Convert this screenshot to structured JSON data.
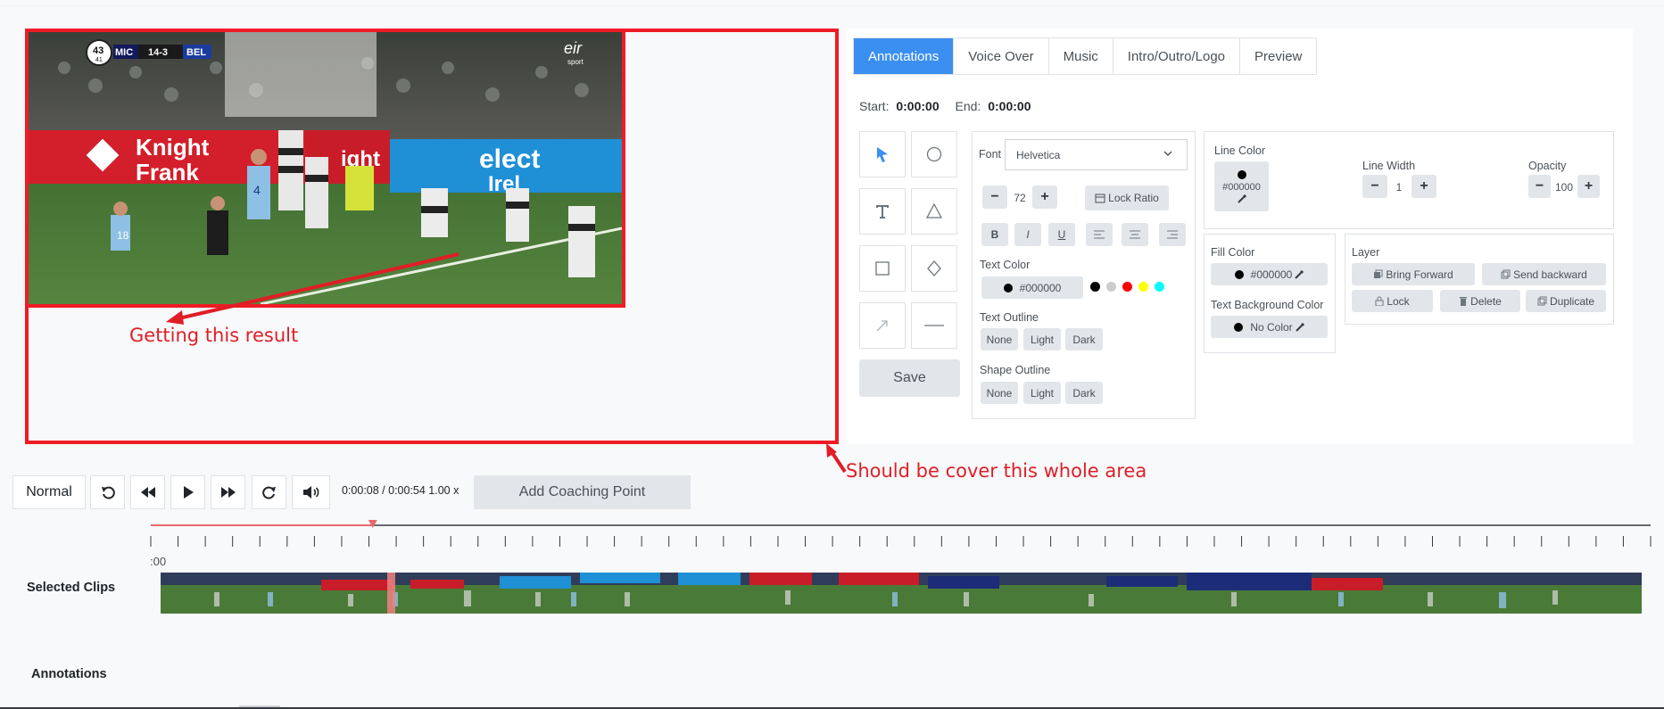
{
  "annotations": {
    "result_label": "Getting this result",
    "cover_label": "Should be cover this whole area"
  },
  "video": {
    "scoreboard": {
      "period": "43",
      "clock": "41",
      "home": "MIC",
      "score": "14-3",
      "away": "BEL"
    },
    "broadcaster": "sport",
    "ads": [
      "Knight Frank",
      "Knight",
      "elect",
      "Irel"
    ],
    "jersey_numbers": [
      "18",
      "4"
    ]
  },
  "tabs": [
    {
      "label": "Annotations",
      "active": true
    },
    {
      "label": "Voice Over",
      "active": false
    },
    {
      "label": "Music",
      "active": false
    },
    {
      "label": "Intro/Outro/Logo",
      "active": false
    },
    {
      "label": "Preview",
      "active": false
    }
  ],
  "times": {
    "start_label": "Start:",
    "start_value": "0:00:00",
    "end_label": "End:",
    "end_value": "0:00:00"
  },
  "tools": [
    {
      "name": "select-icon"
    },
    {
      "name": "circle-icon"
    },
    {
      "name": "text-icon"
    },
    {
      "name": "triangle-icon"
    },
    {
      "name": "square-icon"
    },
    {
      "name": "diamond-icon"
    },
    {
      "name": "arrow-icon"
    },
    {
      "name": "line-icon"
    }
  ],
  "save_label": "Save",
  "font_panel": {
    "font_label": "Font",
    "font_value": "Helvetica",
    "size_value": "72",
    "minus": "−",
    "plus": "+",
    "lock_ratio": "Lock Ratio",
    "format_buttons": [
      "B",
      "I",
      "U"
    ],
    "text_color_label": "Text Color",
    "text_color_value": "#000000",
    "swatches": [
      "#000000",
      "#cccccc",
      "#ff0000",
      "#ffff00",
      "#00ffff"
    ],
    "text_outline_label": "Text Outline",
    "shape_outline_label": "Shape Outline",
    "outline_options": [
      "None",
      "Light",
      "Dark"
    ]
  },
  "line_panel": {
    "line_color_label": "Line Color",
    "line_color_value": "#000000",
    "line_width_label": "Line Width",
    "line_width_value": "1",
    "opacity_label": "Opacity",
    "opacity_value": "100"
  },
  "fill_panel": {
    "fill_color_label": "Fill Color",
    "fill_color_value": "#000000",
    "text_bg_label": "Text Background Color",
    "text_bg_value": "No Color"
  },
  "layer_panel": {
    "layer_label": "Layer",
    "bring_forward": "Bring Forward",
    "send_backward": "Send backward",
    "lock": "Lock",
    "delete": "Delete",
    "duplicate": "Duplicate"
  },
  "player": {
    "speed": "Normal",
    "time_display": "0:00:08 / 0:00:54 1.00 x",
    "add_coaching_point": "Add Coaching Point",
    "progress": 0.148
  },
  "timeline": {
    "tick_start": ":00",
    "selected_clips_label": "Selected Clips",
    "annotations_label": "Annotations"
  },
  "colors": {
    "accent": "#3b8ff0",
    "annotation_red": "#e01e26"
  }
}
